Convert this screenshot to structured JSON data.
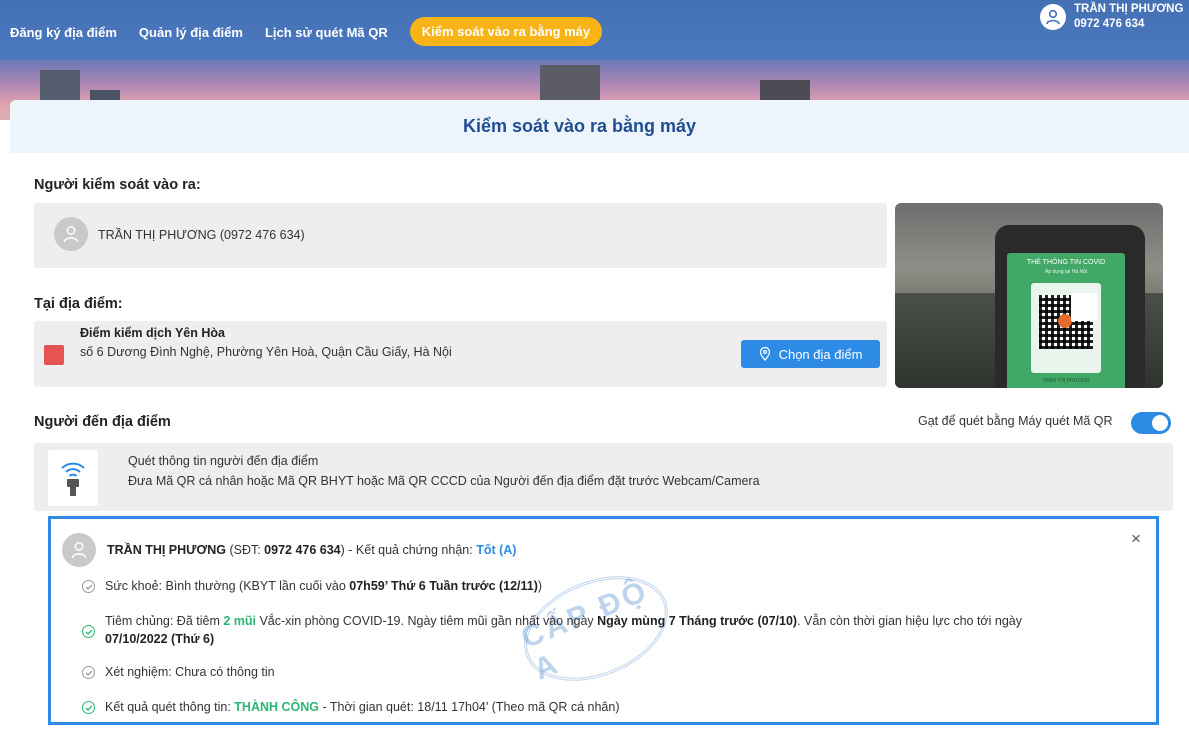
{
  "nav": {
    "items": [
      "Đăng ký địa điểm",
      "Quản lý địa điểm",
      "Lịch sử quét Mã QR"
    ],
    "active": "Kiểm soát vào ra bằng máy"
  },
  "user": {
    "name": "TRẦN THỊ PHƯƠNG",
    "phone": "0972 476 634"
  },
  "page": {
    "title": "Kiểm soát vào ra bằng máy"
  },
  "controller": {
    "label": "Người kiểm soát vào ra:",
    "value": "TRẦN THỊ PHƯƠNG (0972 476 634)"
  },
  "location": {
    "label": "Tại địa điểm:",
    "name": "Điểm kiểm dịch Yên Hòa",
    "address": "số 6 Dương Đình Nghệ, Phường Yên Hoà, Quận Cầu Giấy, Hà Nội",
    "button": "Chọn địa điểm",
    "color": "#e55353"
  },
  "visitor": {
    "label": "Người đến địa điểm",
    "toggle_label": "Gạt để quét bằng Máy quét Mã QR",
    "toggle_on": true,
    "scan_title": "Quét thông tin người đến địa điểm",
    "scan_desc": "Đưa Mã QR cá nhân hoặc Mã QR BHYT hoặc Mã QR CCCD của Người đến địa điểm đặt trước Webcam/Camera"
  },
  "camera": {
    "card_title": "THẺ THÔNG TIN COVID",
    "card_subtitle": "Áp dụng tại Hà Nội",
    "card_owner": "TRẦN THỊ PHƯƠNG"
  },
  "result": {
    "name": "TRẦN THỊ PHƯƠNG",
    "phone_prefix": "(SĐT: ",
    "phone": "0972 476 634",
    "phone_suffix": ")  -  Kết quả chứng nhận: ",
    "grade": "Tốt (A)",
    "health_prefix": "Sức khoẻ: Bình thường (KBYT lần cuối vào ",
    "health_time": "07h59’ Thứ 6 Tuần trước (12/11)",
    "health_suffix": ")",
    "vaccine_prefix": "Tiêm chủng: Đã tiêm ",
    "vaccine_doses": "2 mũi",
    "vaccine_mid": " Vắc-xin phòng COVID-19. Ngày tiêm mũi gần nhất vào ngày ",
    "vaccine_date": "Ngày mùng 7 Tháng trước (07/10)",
    "vaccine_mid2": ". Vẫn còn thời gian hiệu lực cho tới ngày",
    "vaccine_valid": "07/10/2022 (Thứ 6)",
    "test": "Xét nghiệm: Chưa có thông tin",
    "scan_prefix": "Kết quả quét thông tin: ",
    "scan_status": "THÀNH CÔNG",
    "scan_suffix": "  -  Thời gian quét: 18/11 17h04’  (Theo mã QR cá nhân)",
    "stamp": "CẤP ĐỘ A",
    "close": "×"
  },
  "colors": {
    "primary": "#2d8be6",
    "accent": "#f8b317",
    "success": "#2bb673",
    "nav": "#4470b4"
  }
}
